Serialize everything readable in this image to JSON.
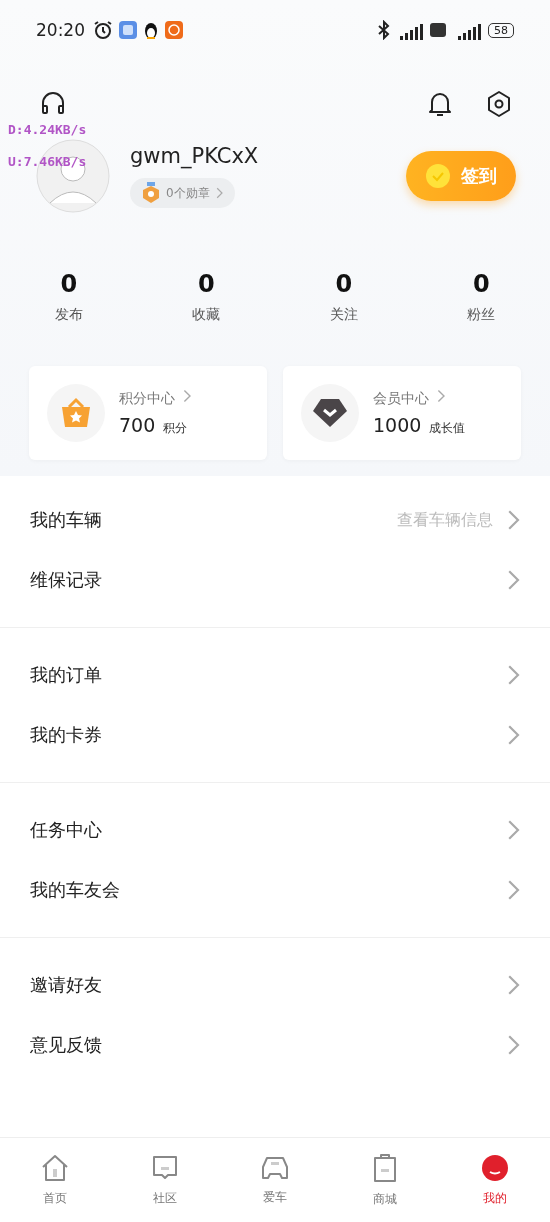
{
  "status_bar": {
    "time": "20:20",
    "battery": "58",
    "network_overlay": [
      "D:4.24KB/s",
      "U:7.46KB/s"
    ]
  },
  "profile": {
    "username": "gwm_PKCxX",
    "medals": "0个勋章",
    "checkin": "签到"
  },
  "stats": [
    {
      "value": "0",
      "label": "发布"
    },
    {
      "value": "0",
      "label": "收藏"
    },
    {
      "value": "0",
      "label": "关注"
    },
    {
      "value": "0",
      "label": "粉丝"
    }
  ],
  "cards": [
    {
      "kind": "points",
      "title": "积分中心",
      "value": "700",
      "unit": "积分"
    },
    {
      "kind": "member",
      "title": "会员中心",
      "value": "1000",
      "unit": "成长值"
    }
  ],
  "menu_sections": [
    [
      {
        "label": "我的车辆",
        "hint": "查看车辆信息"
      },
      {
        "label": "维保记录"
      }
    ],
    [
      {
        "label": "我的订单"
      },
      {
        "label": "我的卡券"
      }
    ],
    [
      {
        "label": "任务中心"
      },
      {
        "label": "我的车友会"
      }
    ],
    [
      {
        "label": "邀请好友"
      },
      {
        "label": "意见反馈"
      }
    ]
  ],
  "bottom_nav": [
    {
      "kind": "home",
      "label": "首页",
      "selected": false
    },
    {
      "kind": "community",
      "label": "社区",
      "selected": false
    },
    {
      "kind": "car",
      "label": "爱车",
      "selected": false
    },
    {
      "kind": "shop",
      "label": "商城",
      "selected": false
    },
    {
      "kind": "me",
      "label": "我的",
      "selected": true
    }
  ]
}
